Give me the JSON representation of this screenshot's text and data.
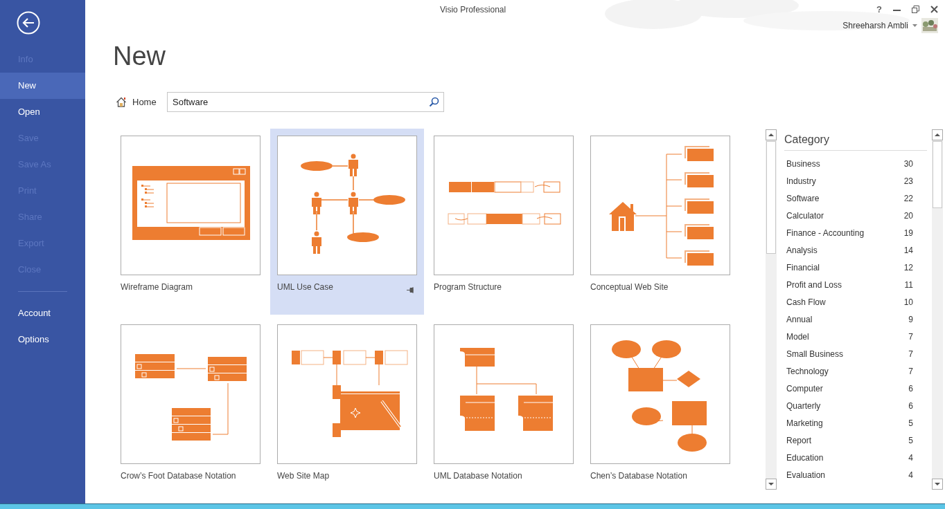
{
  "window": {
    "title": "Visio Professional",
    "help": "?"
  },
  "user": {
    "name": "Shreeharsh Ambli"
  },
  "sidebar": {
    "items": [
      {
        "label": "Info",
        "disabled": true,
        "selected": false
      },
      {
        "label": "New",
        "disabled": false,
        "selected": true
      },
      {
        "label": "Open",
        "disabled": false,
        "selected": false
      },
      {
        "label": "Save",
        "disabled": true,
        "selected": false
      },
      {
        "label": "Save As",
        "disabled": true,
        "selected": false
      },
      {
        "label": "Print",
        "disabled": true,
        "selected": false
      },
      {
        "label": "Share",
        "disabled": true,
        "selected": false
      },
      {
        "label": "Export",
        "disabled": true,
        "selected": false
      },
      {
        "label": "Close",
        "disabled": true,
        "selected": false
      }
    ],
    "footer_items": [
      {
        "label": "Account"
      },
      {
        "label": "Options"
      }
    ]
  },
  "page_title": "New",
  "breadcrumb": "Home",
  "search": {
    "value": "Software"
  },
  "templates": [
    {
      "label": "Wireframe Diagram",
      "selected": false
    },
    {
      "label": "UML Use Case",
      "selected": true
    },
    {
      "label": "Program Structure",
      "selected": false
    },
    {
      "label": "Conceptual Web Site",
      "selected": false
    },
    {
      "label": "Crow’s Foot Database Notation",
      "selected": false
    },
    {
      "label": "Web Site Map",
      "selected": false
    },
    {
      "label": "UML Database Notation",
      "selected": false
    },
    {
      "label": "Chen’s Database Notation",
      "selected": false
    }
  ],
  "category": {
    "title": "Category",
    "items": [
      {
        "name": "Business",
        "count": "30"
      },
      {
        "name": "Industry",
        "count": "23"
      },
      {
        "name": "Software",
        "count": "22"
      },
      {
        "name": "Calculator",
        "count": "20"
      },
      {
        "name": "Finance - Accounting",
        "count": "19"
      },
      {
        "name": "Analysis",
        "count": "14"
      },
      {
        "name": "Financial",
        "count": "12"
      },
      {
        "name": "Profit and Loss",
        "count": "11"
      },
      {
        "name": "Cash Flow",
        "count": "10"
      },
      {
        "name": "Annual",
        "count": "9"
      },
      {
        "name": "Model",
        "count": "7"
      },
      {
        "name": "Small Business",
        "count": "7"
      },
      {
        "name": "Technology",
        "count": "7"
      },
      {
        "name": "Computer",
        "count": "6"
      },
      {
        "name": "Quarterly",
        "count": "6"
      },
      {
        "name": "Marketing",
        "count": "5"
      },
      {
        "name": "Report",
        "count": "5"
      },
      {
        "name": "Education",
        "count": "4"
      },
      {
        "name": "Evaluation",
        "count": "4"
      }
    ]
  }
}
